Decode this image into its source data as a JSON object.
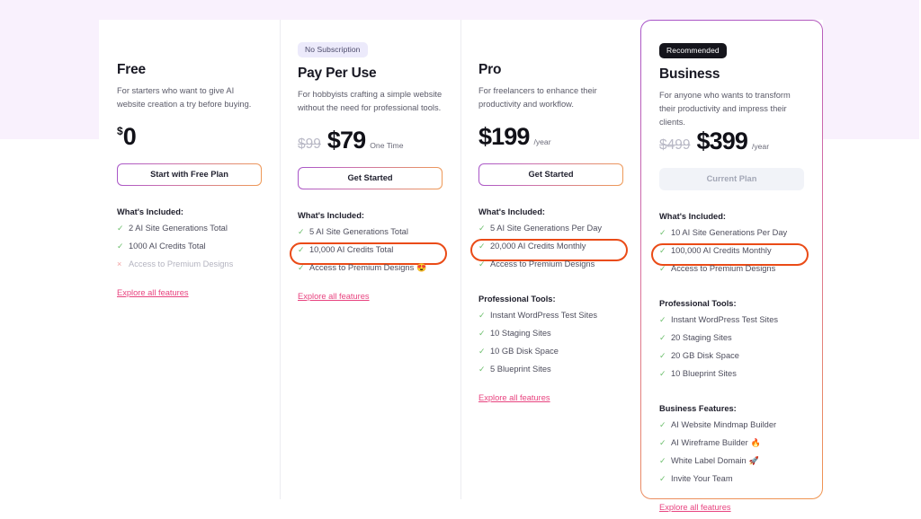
{
  "sections": {
    "included_label": "What's Included:",
    "pro_tools_label": "Professional Tools:",
    "business_label": "Business Features:",
    "explore_label": "Explore all features"
  },
  "plans": [
    {
      "name": "Free",
      "badge": null,
      "description": "For starters who want to give AI website creation a try before buying.",
      "price_superscript": "$",
      "price_old": null,
      "price": "0",
      "price_unit": null,
      "cta": "Start with Free Plan",
      "cta_disabled": false,
      "included": [
        {
          "text": "2 AI Site Generations Total",
          "mark": "check",
          "circled": false
        },
        {
          "text": "1000 AI Credits Total",
          "mark": "check",
          "circled": false
        },
        {
          "text": "Access to Premium Designs",
          "mark": "cross",
          "circled": false
        }
      ],
      "pro_tools": [],
      "business_features": []
    },
    {
      "name": "Pay Per Use",
      "badge": "No Subscription",
      "badge_style": "sub",
      "description": "For hobbyists crafting a simple website without the need for professional tools.",
      "price_superscript": null,
      "price_old": "$99",
      "price": "$79",
      "price_unit": "One Time",
      "cta": "Get Started",
      "cta_disabled": false,
      "included": [
        {
          "text": "5 AI Site Generations Total",
          "mark": "check",
          "circled": false
        },
        {
          "text": "10,000 AI Credits Total",
          "mark": "check",
          "circled": true
        },
        {
          "text": "Access to Premium Designs",
          "mark": "check",
          "circled": false,
          "emoji": "😍"
        }
      ],
      "pro_tools": [],
      "business_features": []
    },
    {
      "name": "Pro",
      "badge": null,
      "description": "For freelancers to enhance their productivity and workflow.",
      "price_superscript": null,
      "price_old": null,
      "price": "$199",
      "price_unit": "/year",
      "cta": "Get Started",
      "cta_disabled": false,
      "included": [
        {
          "text": "5 AI Site Generations Per Day",
          "mark": "check",
          "circled": false
        },
        {
          "text": "20,000 AI Credits Monthly",
          "mark": "check",
          "circled": true
        },
        {
          "text": "Access to Premium Designs",
          "mark": "check",
          "circled": false
        }
      ],
      "pro_tools": [
        {
          "text": "Instant WordPress Test Sites",
          "mark": "check"
        },
        {
          "text": "10 Staging Sites",
          "mark": "check"
        },
        {
          "text": "10 GB Disk Space",
          "mark": "check"
        },
        {
          "text": "5 Blueprint Sites",
          "mark": "check"
        }
      ],
      "business_features": []
    },
    {
      "name": "Business",
      "badge": "Recommended",
      "badge_style": "rec",
      "description": "For anyone who wants to transform their productivity and impress their clients.",
      "price_superscript": null,
      "price_old": "$499",
      "price": "$399",
      "price_unit": "/year",
      "cta": "Current Plan",
      "cta_disabled": true,
      "included": [
        {
          "text": "10 AI Site Generations Per Day",
          "mark": "check",
          "circled": false
        },
        {
          "text": "100,000 AI Credits Monthly",
          "mark": "check",
          "circled": true
        },
        {
          "text": "Access to Premium Designs",
          "mark": "check",
          "circled": false
        }
      ],
      "pro_tools": [
        {
          "text": "Instant WordPress Test Sites",
          "mark": "check"
        },
        {
          "text": "20 Staging Sites",
          "mark": "check"
        },
        {
          "text": "20 GB Disk Space",
          "mark": "check"
        },
        {
          "text": "10 Blueprint Sites",
          "mark": "check"
        }
      ],
      "business_features": [
        {
          "text": "AI Website Mindmap Builder",
          "mark": "check"
        },
        {
          "text": "AI Wireframe Builder",
          "mark": "check",
          "emoji": "🔥"
        },
        {
          "text": "White Label Domain",
          "mark": "check",
          "emoji": "🚀"
        },
        {
          "text": "Invite Your Team",
          "mark": "check"
        }
      ]
    }
  ],
  "colors": {
    "band": "#f9f1fd",
    "accent_link": "#e8437f",
    "annotation": "#ea4b17",
    "check": "#6cbf6c",
    "cross": "#f3a0a0"
  }
}
